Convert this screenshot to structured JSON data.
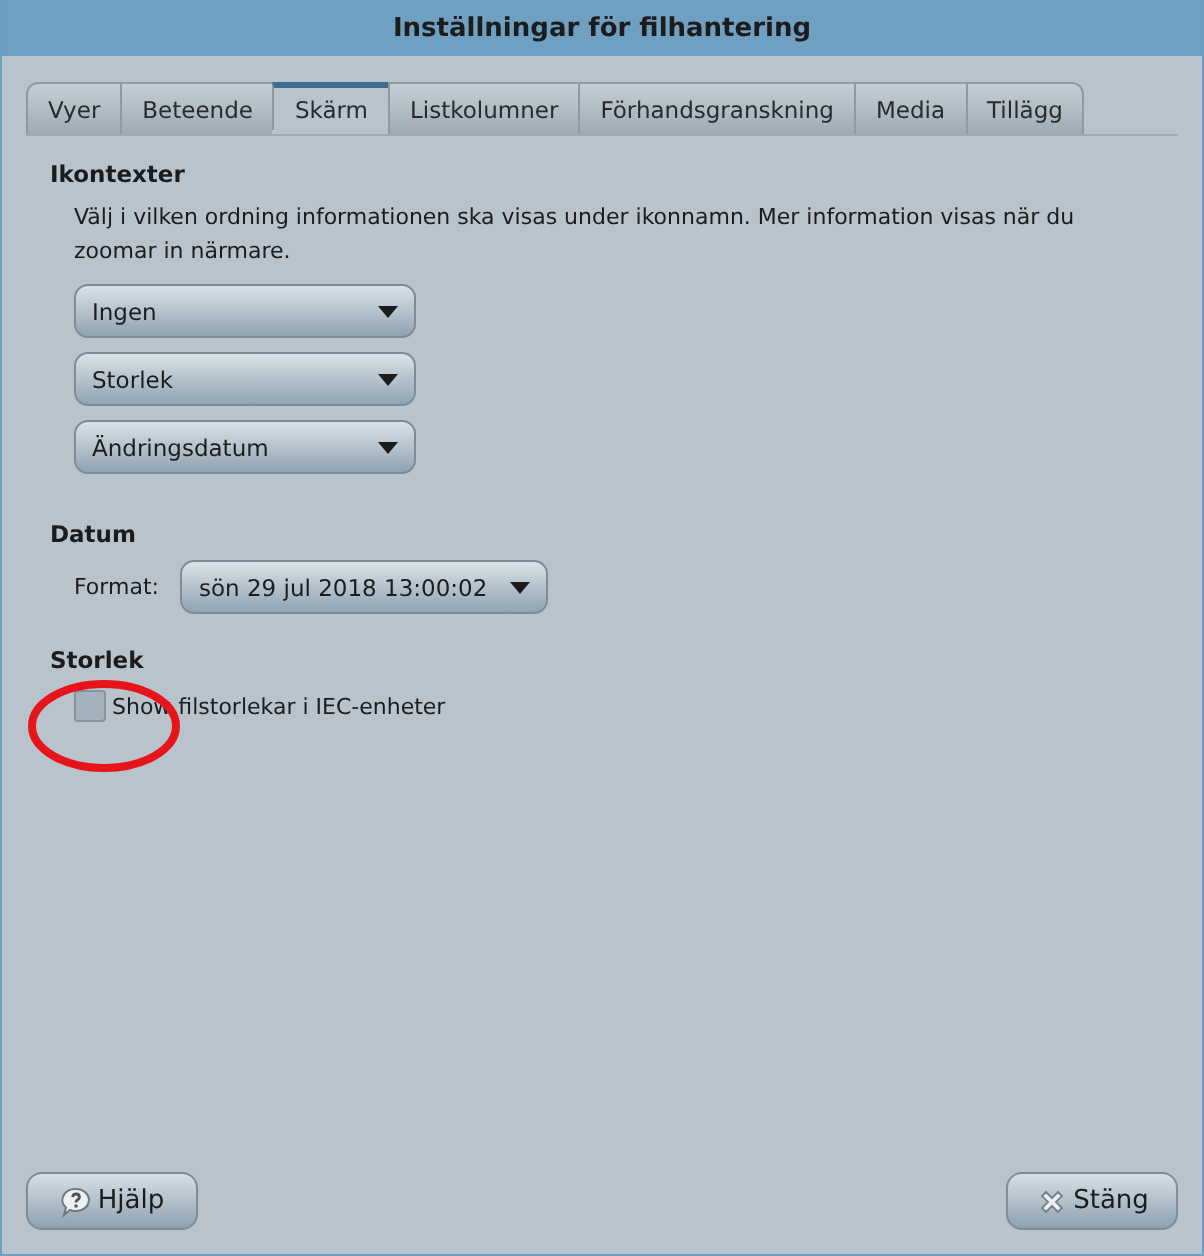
{
  "window": {
    "title": "Inställningar för filhantering"
  },
  "tabs": [
    {
      "label": "Vyer",
      "selected": false
    },
    {
      "label": "Beteende",
      "selected": false
    },
    {
      "label": "Skärm",
      "selected": true
    },
    {
      "label": "Listkolumner",
      "selected": false
    },
    {
      "label": "Förhandsgranskning",
      "selected": false
    },
    {
      "label": "Media",
      "selected": false
    },
    {
      "label": "Tillägg",
      "selected": false
    }
  ],
  "icon_captions": {
    "heading": "Ikontexter",
    "description": "Välj i vilken ordning informationen ska visas under ikonnamn. Mer information visas när du zoomar in närmare.",
    "dropdowns": [
      "Ingen",
      "Storlek",
      "Ändringsdatum"
    ]
  },
  "date": {
    "heading": "Datum",
    "label": "Format:",
    "value": "sön 29 jul 2018 13:00:02"
  },
  "size": {
    "heading": "Storlek",
    "checkbox": {
      "label": "Show filstorlekar i IEC-enheter",
      "checked": false
    }
  },
  "annotation": {
    "kind": "ellipse",
    "color": "#e8141b"
  },
  "buttons": [
    {
      "kind": "help",
      "label": "Hjälp"
    },
    {
      "kind": "close",
      "label": "Stäng"
    }
  ]
}
